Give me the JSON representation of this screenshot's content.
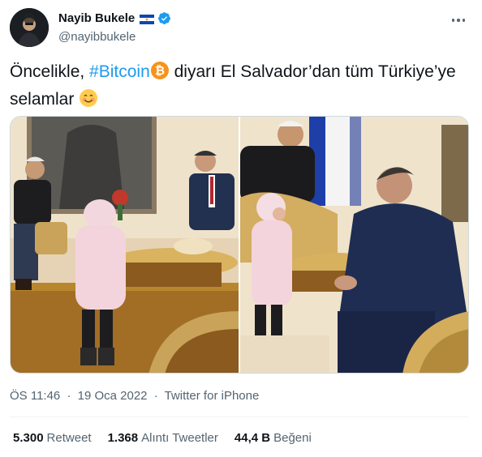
{
  "author": {
    "display_name": "Nayib Bukele",
    "handle": "@nayibbukele",
    "flag_icon": "el-salvador-flag-icon",
    "verified_icon": "verified-badge-icon",
    "verified_color": "#1d9bf0"
  },
  "tweet": {
    "text_before": "Öncelikle, ",
    "hashtag": "#Bitcoin",
    "text_after": " diyarı El Salvador’dan tüm Türkiye’ye selamlar",
    "emoji_bitcoin": "bitcoin-emoji",
    "emoji_smile": "smiling-face-emoji"
  },
  "meta": {
    "time": "ÖS 11:46",
    "date": "19 Oca 2022",
    "separator": "·",
    "source": "Twitter for iPhone"
  },
  "stats": {
    "retweets_count": "5.300",
    "retweets_label": "Retweet",
    "quotes_count": "1.368",
    "quotes_label": "Alıntı Tweetler",
    "likes_count": "44,4 B",
    "likes_label": "Beğeni"
  },
  "colors": {
    "accent": "#1d9bf0",
    "text_primary": "#0f1419",
    "text_secondary": "#536471",
    "border": "#eff3f4"
  }
}
